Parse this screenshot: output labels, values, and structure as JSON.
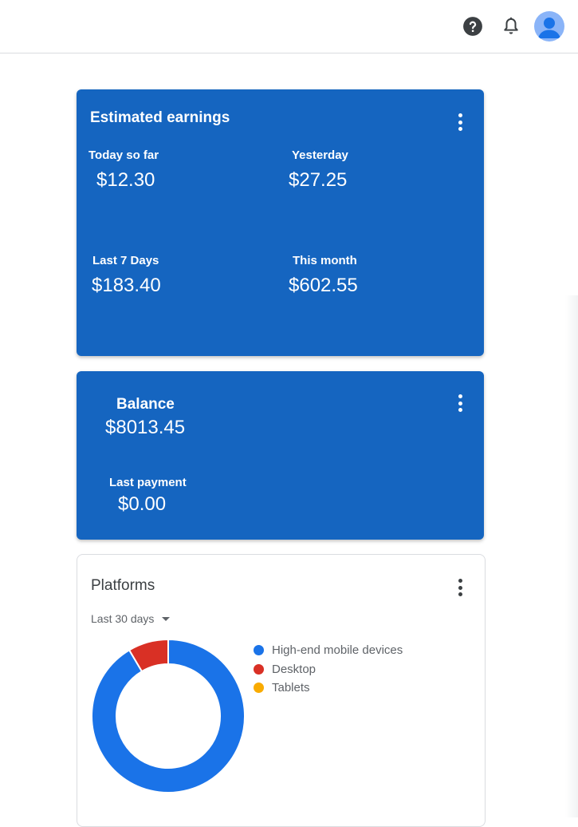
{
  "header": {
    "help_icon": "help-circle-icon",
    "notifications_icon": "bell-icon",
    "avatar_icon": "account-avatar-icon"
  },
  "earnings": {
    "title": "Estimated earnings",
    "today_label": "Today so far",
    "today_value": "$12.30",
    "yesterday_label": "Yesterday",
    "yesterday_value": "$27.25",
    "last7_label": "Last 7 Days",
    "last7_value": "$183.40",
    "month_label": "This month",
    "month_value": "$602.55",
    "menu_icon": "more-vert-icon"
  },
  "balance": {
    "title": "Balance",
    "value": "$8013.45",
    "last_payment_label": "Last payment",
    "last_payment_value": "$0.00",
    "menu_icon": "more-vert-icon"
  },
  "platforms": {
    "title": "Platforms",
    "range": "Last 30 days",
    "menu_icon": "more-vert-icon"
  },
  "colors": {
    "card_blue": "#1565c0",
    "series_mobile": "#1a73e8",
    "series_desktop": "#d93025",
    "series_tablets": "#f9ab00"
  },
  "chart_data": {
    "type": "pie",
    "title": "",
    "labels": [
      "High-end mobile devices",
      "Desktop",
      "Tablets"
    ],
    "values": [
      91.5,
      8.5,
      0
    ],
    "colors": [
      "#1a73e8",
      "#d93025",
      "#f9ab00"
    ],
    "legend": "right",
    "donut": true
  }
}
